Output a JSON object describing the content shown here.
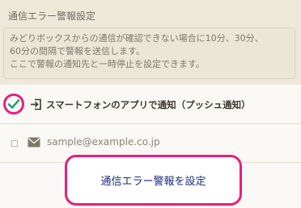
{
  "section": {
    "title": "通信エラー警報設定"
  },
  "notice": {
    "lines": [
      "みどりボックスからの通信が確認できない場合に10分、30分、",
      "60分の間隔で警報を送信します。",
      "ここで警報の通知先と一時停止を設定できます。"
    ]
  },
  "options": {
    "push": {
      "label": "スマートフォンのアプリで通知（プッシュ通知）",
      "checked": true,
      "icon": "login-arrow-icon"
    },
    "email": {
      "label": "sample@example.co.jp",
      "checked": false,
      "icon": "mail-icon"
    }
  },
  "actions": {
    "setup_label": "通信エラー警報を設定"
  },
  "colors": {
    "accent": "#e6207a",
    "check": "#1fa37a",
    "button_text": "#1d2c7a"
  }
}
